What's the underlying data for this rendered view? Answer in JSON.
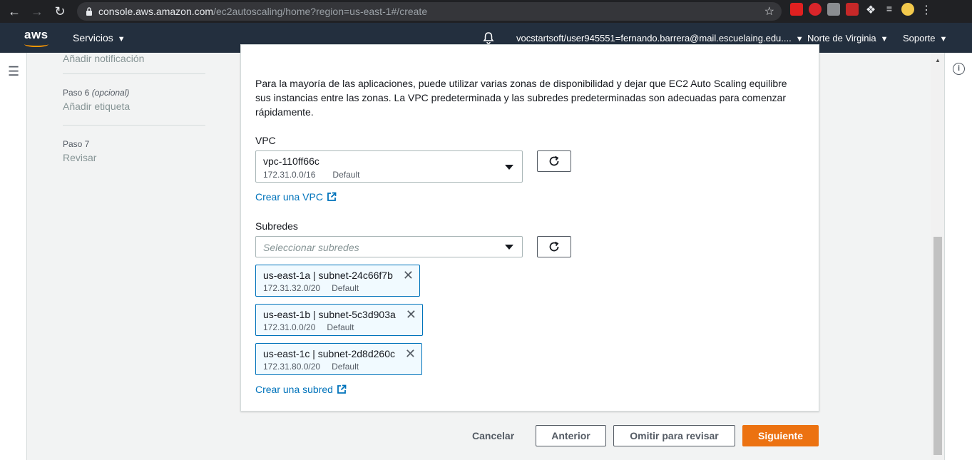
{
  "browser": {
    "url_host": "console.aws.amazon.com",
    "url_path": "/ec2autoscaling/home?region=us-east-1#/create"
  },
  "header": {
    "logo": "aws",
    "services": "Servicios",
    "account": "vocstartsoft/user945551=fernando.barrera@mail.escuelaing.edu....",
    "region": "Norte de Virginia",
    "support": "Soporte"
  },
  "steps": [
    {
      "number": "",
      "name": "Añadir notificación"
    },
    {
      "number": "Paso 6",
      "optional": "(opcional)",
      "name": "Añadir etiqueta"
    },
    {
      "number": "Paso 7",
      "name": "Revisar"
    }
  ],
  "network": {
    "description": "Para la mayoría de las aplicaciones, puede utilizar varias zonas de disponibilidad y dejar que EC2 Auto Scaling equilibre sus instancias entre las zonas. La VPC predeterminada y las subredes predeterminadas son adecuadas para comenzar rápidamente.",
    "vpc_label": "VPC",
    "vpc_value": "vpc-110ff66c",
    "vpc_cidr": "172.31.0.0/16",
    "vpc_default": "Default",
    "create_vpc": "Crear una VPC",
    "subnets_label": "Subredes",
    "subnets_placeholder": "Seleccionar subredes",
    "subnets": [
      {
        "name": "us-east-1a | subnet-24c66f7b",
        "cidr": "172.31.32.0/20",
        "tag": "Default"
      },
      {
        "name": "us-east-1b | subnet-5c3d903a",
        "cidr": "172.31.0.0/20",
        "tag": "Default"
      },
      {
        "name": "us-east-1c | subnet-2d8d260c",
        "cidr": "172.31.80.0/20",
        "tag": "Default"
      }
    ],
    "create_subnet": "Crear una subred"
  },
  "footer": {
    "cancel": "Cancelar",
    "previous": "Anterior",
    "skip": "Omitir para revisar",
    "next": "Siguiente"
  },
  "colors": {
    "primary": "#ec7211",
    "link": "#0073bb",
    "header": "#232f3e"
  }
}
